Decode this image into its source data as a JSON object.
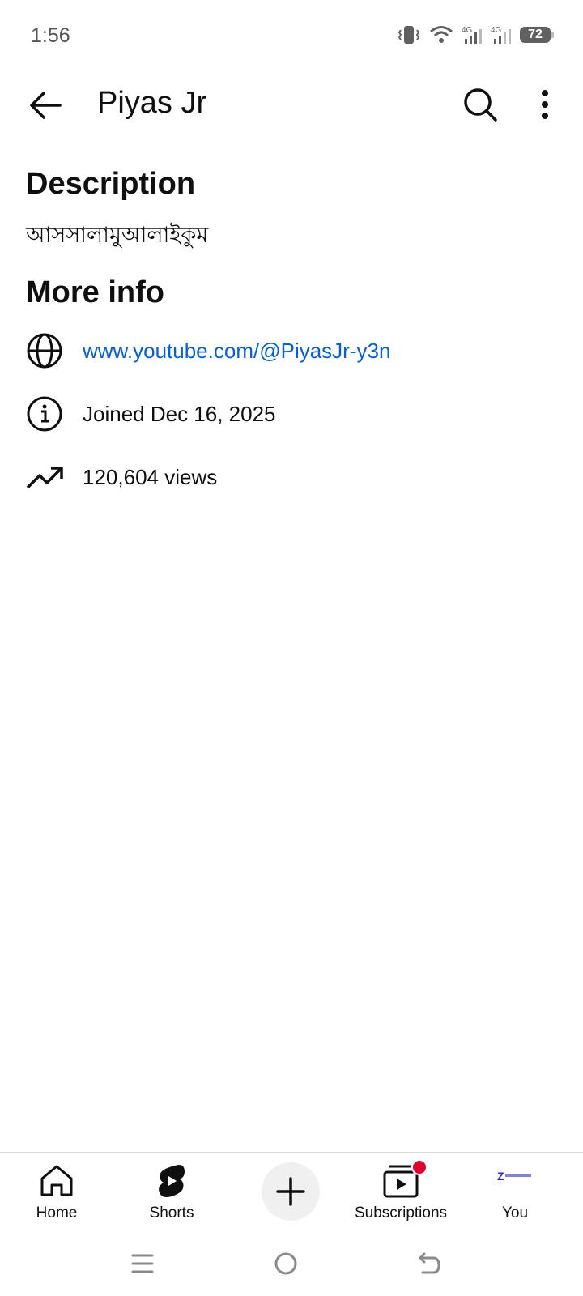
{
  "status_bar": {
    "time": "1:56",
    "battery_level": "72",
    "network_1": "4G",
    "network_2": "4G"
  },
  "app_bar": {
    "title": "Piyas Jr",
    "icons": [
      "arrow-back-icon",
      "search-icon",
      "more-vert-icon"
    ]
  },
  "description": {
    "heading": "Description",
    "text": "আসসালামুআলাইকুম"
  },
  "more_info": {
    "heading": "More info",
    "items": [
      {
        "icon": "globe-icon",
        "text": "www.youtube.com/@PiyasJr-y3n",
        "color": "#065fd4"
      },
      {
        "icon": "info-icon",
        "text": "Joined Dec 16, 2025"
      },
      {
        "icon": "trending-up-icon",
        "text": "120,604 views"
      }
    ]
  },
  "bottom_nav": {
    "items": [
      {
        "label": "Home",
        "icon": "home-icon"
      },
      {
        "label": "Shorts",
        "icon": "shorts-icon"
      },
      {
        "label": "",
        "icon": "create-plus-icon"
      },
      {
        "label": "Subscriptions",
        "icon": "subscriptions-icon"
      },
      {
        "label": "You",
        "icon": "avatar"
      }
    ],
    "notification_color": "#e1002d"
  },
  "system_nav": {
    "icons": [
      "menu-icon",
      "home-circle-icon",
      "back-icon"
    ]
  },
  "colors": {
    "link": "#065fd4",
    "text": "#0f0f0f",
    "background": "#ffffff"
  }
}
